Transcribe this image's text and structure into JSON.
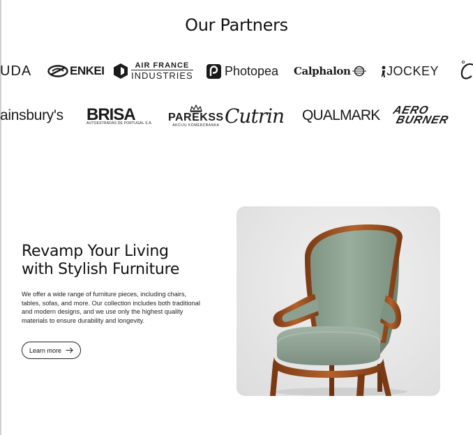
{
  "partners": {
    "title": "Our Partners",
    "row1": {
      "uda": "UDA",
      "enkei": "ENKEI",
      "air_france_top": "AIR FRANCE",
      "air_france_bottom": "INDUSTRIES",
      "photopea": "Photopea",
      "calphalon": "Calphalon",
      "jockey": "JOCKEY"
    },
    "row2": {
      "sainsbury": "ainsbury's",
      "brisa": "BRISA",
      "brisa_sub": "AUTOESTRADAS DE PORTUGAL S.A.",
      "parekss": "PAREKSS",
      "parekss_sub": "AKCIJU KOMERCBANKA",
      "cutrin": "Cutrin",
      "qualmark": "QUALMARK",
      "aero": "AERO",
      "burner": "BURNER"
    }
  },
  "feature": {
    "title_line1": "Revamp Your Living",
    "title_line2": "with Stylish Furniture",
    "description": "We offer a wide range of furniture pieces, including chairs, tables, sofas, and more. Our collection includes both traditional and modern designs, and we use only the highest quality materials to ensure durability and longevity.",
    "button_label": "Learn more"
  },
  "colors": {
    "chair_upholstery": "#8fa393",
    "chair_wood": "#9a4e21",
    "card_background": "#e6e6e6"
  }
}
